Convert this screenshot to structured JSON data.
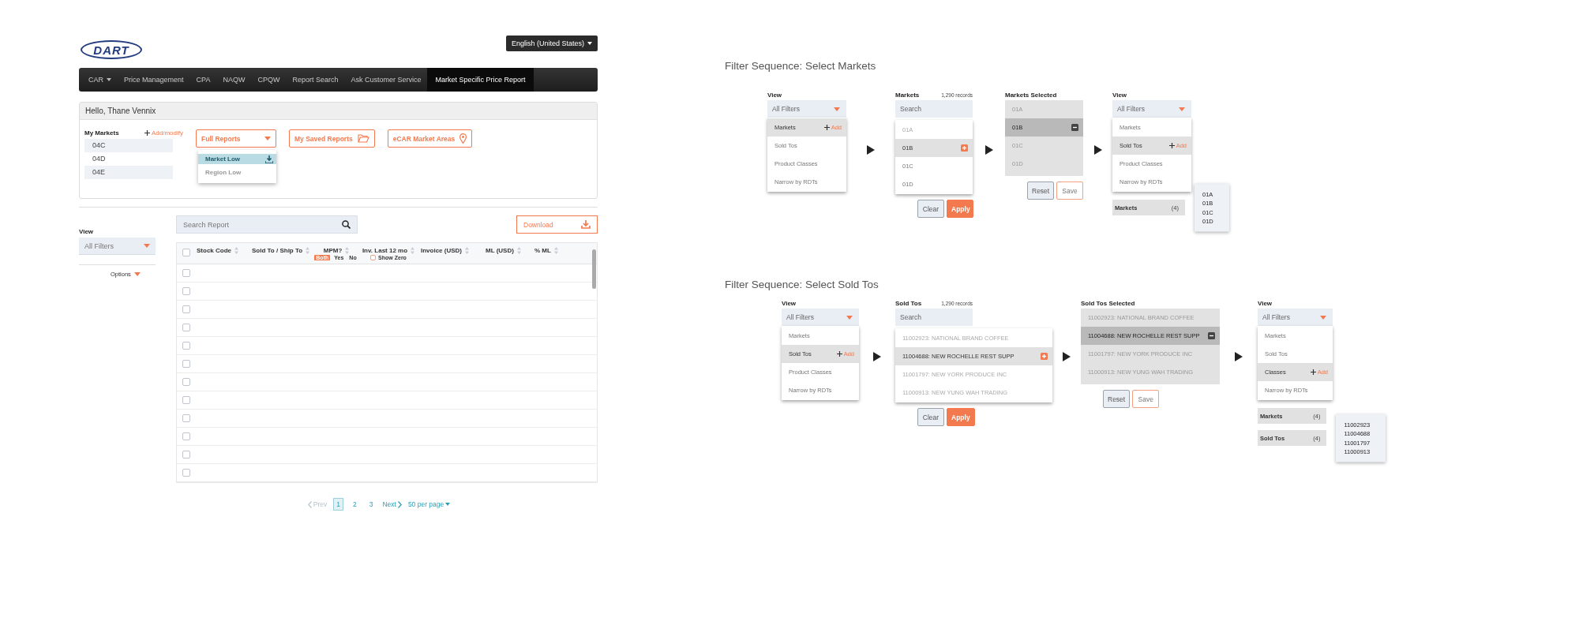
{
  "header": {
    "logo": "DART",
    "language": "English (United States)"
  },
  "nav": [
    {
      "label": "CAR",
      "kind": "dropdown",
      "selected": false
    },
    {
      "label": "Price Management",
      "kind": "link",
      "selected": false
    },
    {
      "label": "CPA",
      "kind": "link",
      "selected": false
    },
    {
      "label": "NAQW",
      "kind": "link",
      "selected": false
    },
    {
      "label": "CPQW",
      "kind": "link",
      "selected": false
    },
    {
      "label": "Report Search",
      "kind": "link",
      "selected": false
    },
    {
      "label": "Ask Customer Service",
      "kind": "link",
      "selected": false
    },
    {
      "label": "Market Specific Price Report",
      "kind": "link",
      "selected": true
    }
  ],
  "account_panel": {
    "greeting": "Hello, Thane Vennix",
    "my_markets": {
      "title": "My Markets",
      "action": "Add/modify",
      "items": [
        "04C",
        "04D",
        "04E"
      ]
    },
    "reports_dropdown": {
      "label": "Full Reports",
      "options": [
        {
          "label": "Market Low",
          "selected": true
        },
        {
          "label": "Region Low",
          "selected": false
        }
      ]
    },
    "buttons": [
      {
        "label": "My Saved Reports",
        "kind": "folder"
      },
      {
        "label": "eCAR Market Areas",
        "kind": "pin"
      }
    ]
  },
  "view_sidebar": {
    "label": "View",
    "dropdown": "All Filters",
    "options": "Options"
  },
  "report": {
    "search": {
      "placeholder": "Search Report"
    },
    "download": "Download",
    "select_all": {
      "checked": false
    },
    "columns": [
      {
        "label": "Stock Code",
        "kind": "plain"
      },
      {
        "label": "Sold To / Ship To",
        "kind": "plain"
      },
      {
        "label": "MPM?",
        "kind": "toggle",
        "options": [
          {
            "label": "Both",
            "selected": true
          },
          {
            "label": "Yes",
            "selected": false
          },
          {
            "label": "No",
            "selected": false
          }
        ]
      },
      {
        "label": "Inv. Last 12 mo",
        "kind": "checkbox",
        "option": {
          "label": "Show Zero",
          "checked": false
        }
      },
      {
        "label": "Invoice (USD)",
        "kind": "plain"
      },
      {
        "label": "ML (USD)",
        "kind": "plain"
      },
      {
        "label": "% ML",
        "kind": "plain"
      }
    ],
    "rows": [
      {
        "checked": false
      },
      {
        "checked": false
      },
      {
        "checked": false
      },
      {
        "checked": false
      },
      {
        "checked": false
      },
      {
        "checked": false
      },
      {
        "checked": false
      },
      {
        "checked": false
      },
      {
        "checked": false
      },
      {
        "checked": false
      },
      {
        "checked": false
      },
      {
        "checked": false
      }
    ]
  },
  "pagination": {
    "prev": {
      "label": "Prev",
      "disabled": true
    },
    "pages": [
      {
        "label": "1",
        "selected": true
      },
      {
        "label": "2",
        "selected": false
      },
      {
        "label": "3",
        "selected": false
      }
    ],
    "next": {
      "label": "Next",
      "disabled": false
    },
    "per_page": "50 per page"
  },
  "sequences": [
    {
      "title": "Filter Sequence: Select Markets",
      "steps": [
        {
          "kind": "view",
          "label": "View",
          "dropdown": "All Filters",
          "items": [
            {
              "label": "Markets",
              "selected": true,
              "action": "Add"
            },
            {
              "label": "Sold Tos",
              "selected": false
            },
            {
              "label": "Product Classes",
              "selected": false
            },
            {
              "label": "Narrow by RDTs",
              "selected": false
            }
          ]
        },
        {
          "kind": "search",
          "label": "Markets",
          "count": "1,290 records",
          "placeholder": "Search",
          "items": [
            {
              "label": "01A",
              "selected": false,
              "disabled": true
            },
            {
              "label": "01B",
              "selected": true,
              "disabled": false
            },
            {
              "label": "01C",
              "selected": false,
              "disabled": false
            },
            {
              "label": "01D",
              "selected": false,
              "disabled": false
            }
          ],
          "buttons": [
            {
              "label": "Clear",
              "kind": "secondary"
            },
            {
              "label": "Apply",
              "kind": "primary"
            }
          ]
        },
        {
          "kind": "selected",
          "label": "Markets Selected",
          "items": [
            {
              "label": "01A",
              "selected": false
            },
            {
              "label": "01B",
              "selected": true
            },
            {
              "label": "01C",
              "selected": false
            },
            {
              "label": "01D",
              "selected": false
            }
          ],
          "buttons": [
            {
              "label": "Reset",
              "kind": "secondary"
            },
            {
              "label": "Save",
              "kind": "outline"
            }
          ]
        },
        {
          "kind": "view",
          "label": "View",
          "dropdown": "All Filters",
          "items": [
            {
              "label": "Markets",
              "selected": false
            },
            {
              "label": "Sold Tos",
              "selected": true,
              "action": "Add"
            },
            {
              "label": "Product Classes",
              "selected": false
            },
            {
              "label": "Narrow by RDTs",
              "selected": false
            }
          ],
          "summaries": [
            {
              "label": "Markets",
              "count": "(4)"
            }
          ],
          "tooltip": [
            "01A",
            "01B",
            "01C",
            "01D"
          ]
        }
      ]
    },
    {
      "title": "Filter Sequence: Select Sold Tos",
      "steps": [
        {
          "kind": "view",
          "label": "View",
          "dropdown": "All Filters",
          "items": [
            {
              "label": "Markets",
              "selected": false
            },
            {
              "label": "Sold Tos",
              "selected": true,
              "action": "Add"
            },
            {
              "label": "Product Classes",
              "selected": false
            },
            {
              "label": "Narrow by RDTs",
              "selected": false
            }
          ]
        },
        {
          "kind": "search",
          "label": "Sold Tos",
          "count": "1,290 records",
          "placeholder": "Search",
          "items": [
            {
              "label": "11002923: NATIONAL BRAND COFFEE",
              "selected": false,
              "disabled": true
            },
            {
              "label": "11004688: NEW ROCHELLE REST SUPP",
              "selected": true,
              "disabled": false
            },
            {
              "label": "11001797: NEW YORK PRODUCE INC",
              "selected": false,
              "disabled": true
            },
            {
              "label": "11000913: NEW YUNG WAH TRADING",
              "selected": false,
              "disabled": true
            }
          ],
          "buttons": [
            {
              "label": "Clear",
              "kind": "secondary"
            },
            {
              "label": "Apply",
              "kind": "primary"
            }
          ]
        },
        {
          "kind": "selected",
          "label": "Sold Tos Selected",
          "items": [
            {
              "label": "11002923: NATIONAL BRAND COFFEE",
              "selected": false
            },
            {
              "label": "11004688: NEW ROCHELLE REST SUPP",
              "selected": true
            },
            {
              "label": "11001797: NEW YORK PRODUCE INC",
              "selected": false
            },
            {
              "label": "11000913: NEW YUNG WAH TRADING",
              "selected": false
            }
          ],
          "buttons": [
            {
              "label": "Reset",
              "kind": "secondary"
            },
            {
              "label": "Save",
              "kind": "outline"
            }
          ]
        },
        {
          "kind": "view",
          "label": "View",
          "dropdown": "All Filters",
          "items": [
            {
              "label": "Markets",
              "selected": false
            },
            {
              "label": "Sold Tos",
              "selected": false
            },
            {
              "label": "Classes",
              "selected": true,
              "action": "Add"
            },
            {
              "label": "Narrow by RDTs",
              "selected": false
            }
          ],
          "summaries": [
            {
              "label": "Markets",
              "count": "(4)"
            },
            {
              "label": "Sold Tos",
              "count": "(4)"
            }
          ],
          "tooltip": [
            "11002923",
            "11004688",
            "11001797",
            "11000913"
          ]
        }
      ]
    }
  ]
}
